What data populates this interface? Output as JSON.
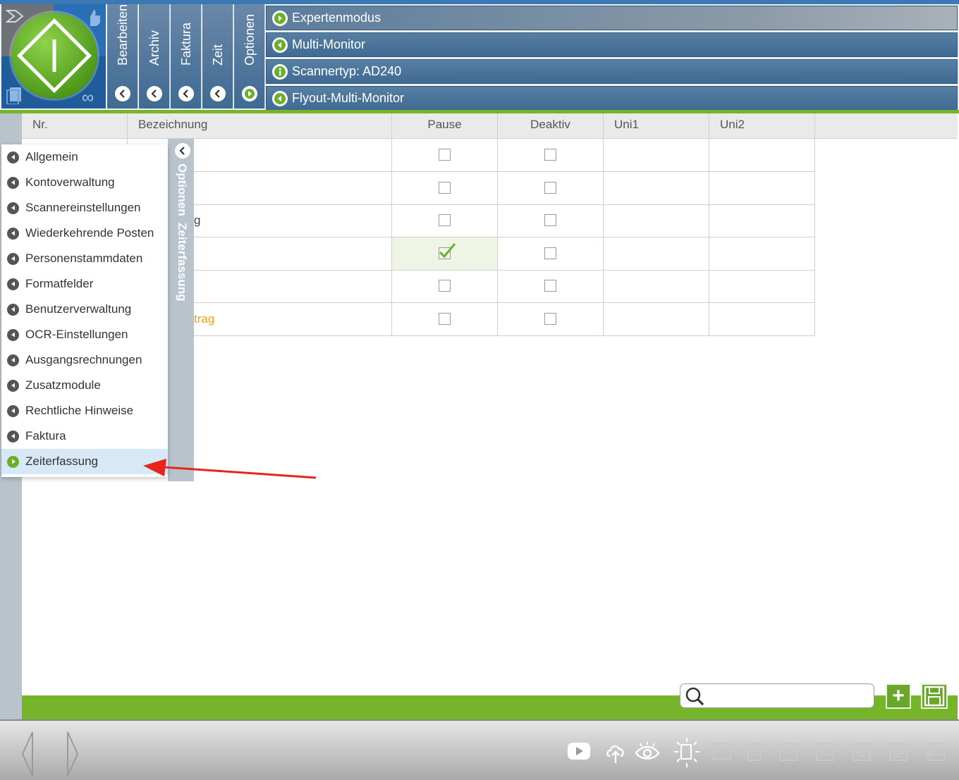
{
  "header": {
    "vtabs": [
      {
        "label": "Bearbeiten",
        "state": "left"
      },
      {
        "label": "Archiv",
        "state": "left"
      },
      {
        "label": "Faktura",
        "state": "left"
      },
      {
        "label": "Zeit",
        "state": "left"
      },
      {
        "label": "Optionen",
        "state": "right"
      }
    ],
    "rows": [
      {
        "label": "Expertenmodus",
        "icon": "play-right-icon"
      },
      {
        "label": "Multi-Monitor",
        "icon": "play-left-icon"
      },
      {
        "label": "Scannertyp: AD240",
        "icon": "info-icon"
      },
      {
        "label": "Flyout-Multi-Monitor",
        "icon": "play-left-icon"
      }
    ]
  },
  "table": {
    "columns": [
      "Nr.",
      "Bezeichnung",
      "Pause",
      "Deaktiv",
      "Uni1",
      "Uni2"
    ],
    "rows": [
      {
        "bezeichnung": "",
        "pause": false,
        "deaktiv": false
      },
      {
        "bezeichnung": "",
        "pause": false,
        "deaktiv": false
      },
      {
        "bezeichnung": "g",
        "pause": false,
        "deaktiv": false
      },
      {
        "bezeichnung": "",
        "pause": true,
        "deaktiv": false
      },
      {
        "bezeichnung": "",
        "pause": false,
        "deaktiv": false
      },
      {
        "bezeichnung": "trag",
        "pause": false,
        "deaktiv": false
      }
    ]
  },
  "flyout": {
    "tab_label": "Optionen  Zeiterfassung",
    "items": [
      {
        "label": "Allgemein",
        "active": false
      },
      {
        "label": "Kontoverwaltung",
        "active": false
      },
      {
        "label": "Scannereinstellungen",
        "active": false
      },
      {
        "label": "Wiederkehrende Posten",
        "active": false
      },
      {
        "label": "Personenstammdaten",
        "active": false
      },
      {
        "label": "Formatfelder",
        "active": false
      },
      {
        "label": "Benutzerverwaltung",
        "active": false
      },
      {
        "label": "OCR-Einstellungen",
        "active": false
      },
      {
        "label": "Ausgangsrechnungen",
        "active": false
      },
      {
        "label": "Zusatzmodule",
        "active": false
      },
      {
        "label": "Rechtliche Hinweise",
        "active": false
      },
      {
        "label": "Faktura",
        "active": false
      },
      {
        "label": "Zeiterfassung",
        "active": true
      }
    ]
  },
  "search": {
    "value": "",
    "placeholder": ""
  },
  "footer": {
    "icons": [
      "youtube-icon",
      "cloud-upload-icon",
      "eye-icon",
      "scanner-light-icon",
      "window-icon",
      "document-edit-icon",
      "save-icon",
      "settings-icon",
      "euro-icon",
      "at-icon",
      "mail-icon"
    ]
  },
  "colors": {
    "accent_green": "#76b52a",
    "header_blue": "#3f6a93",
    "active_item": "#d7e8f6",
    "orange_text": "#f0a010",
    "annotation_arrow": "#e8241c"
  }
}
